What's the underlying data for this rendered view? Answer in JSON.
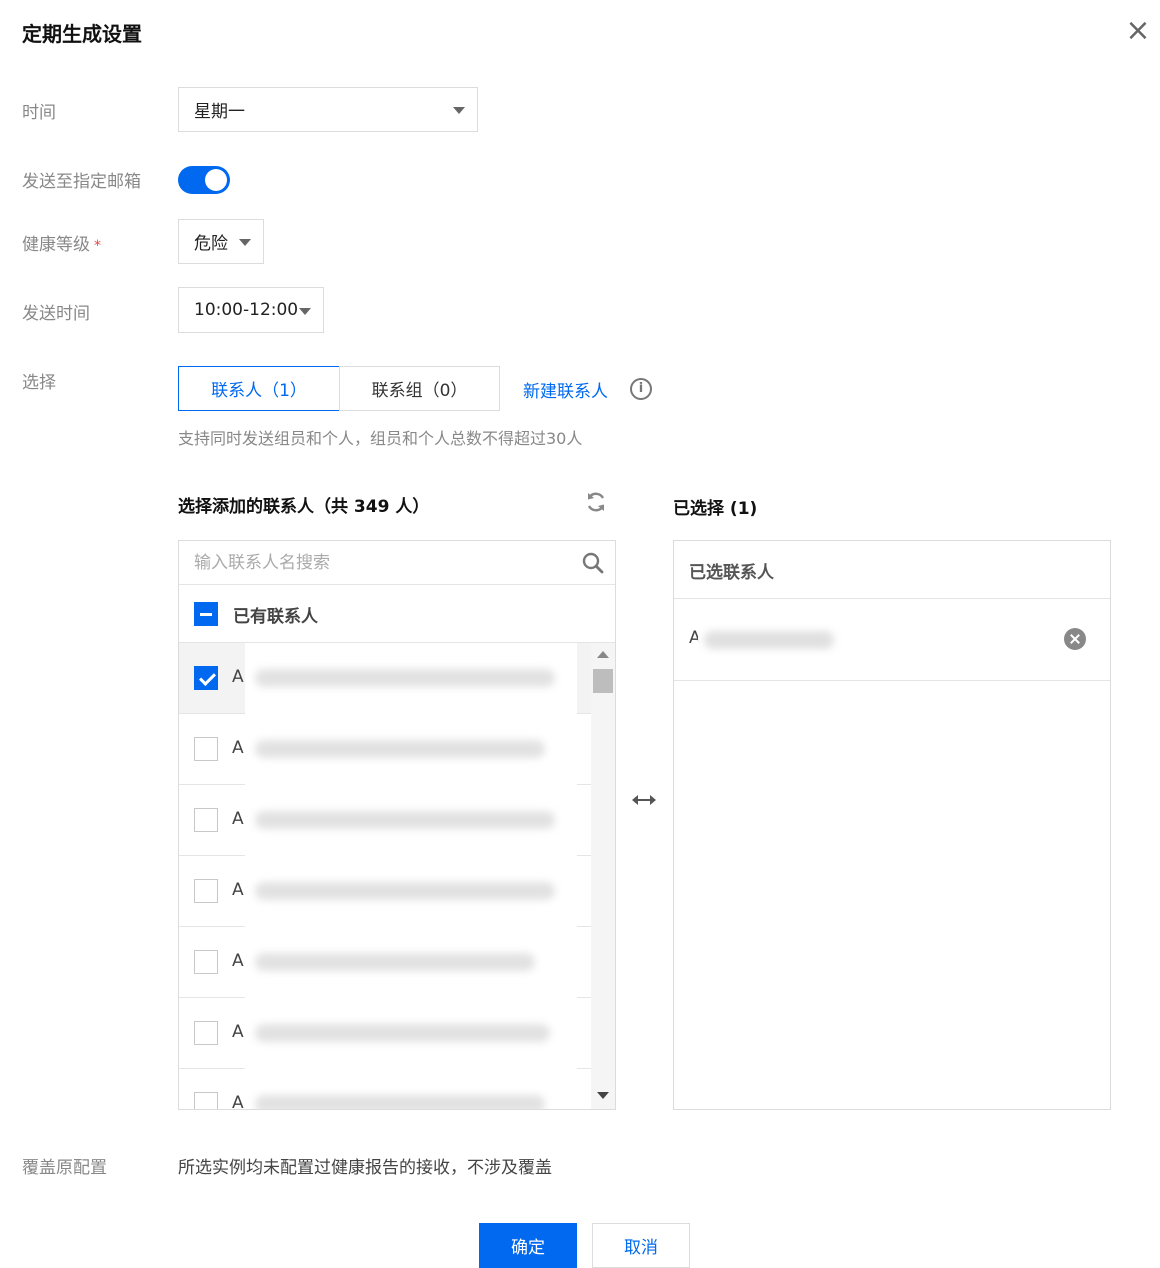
{
  "dialog": {
    "title": "定期生成设置",
    "close_icon": "close-icon"
  },
  "form": {
    "time": {
      "label": "时间",
      "value": "星期一"
    },
    "send_email": {
      "label": "发送至指定邮箱",
      "enabled": true
    },
    "health_level": {
      "label": "健康等级",
      "required_mark": "*",
      "value": "危险"
    },
    "send_time": {
      "label": "发送时间",
      "value": "10:00-12:00"
    },
    "select": {
      "label": "选择",
      "tabs": [
        {
          "label": "联系人（1）",
          "active": true
        },
        {
          "label": "联系组（0）",
          "active": false
        }
      ],
      "new_contact_link": "新建联系人",
      "hint": "支持同时发送组员和个人，组员和个人总数不得超过30人"
    }
  },
  "transfer": {
    "left": {
      "title": "选择添加的联系人（共 349 人）",
      "search_placeholder": "输入联系人名搜索",
      "group_label": "已有联系人",
      "items": [
        {
          "text": "A",
          "checked": true
        },
        {
          "text": "A",
          "checked": false
        },
        {
          "text": "A",
          "checked": false
        },
        {
          "text": "A",
          "checked": false
        },
        {
          "text": "A",
          "checked": false
        },
        {
          "text": "A",
          "checked": false
        },
        {
          "text": "A",
          "checked": false
        }
      ]
    },
    "right": {
      "title": "已选择 (1)",
      "header": "已选联系人",
      "items": [
        {
          "text": "A"
        }
      ]
    }
  },
  "override": {
    "label": "覆盖原配置",
    "text": "所选实例均未配置过健康报告的接收，不涉及覆盖"
  },
  "footer": {
    "confirm": "确定",
    "cancel": "取消"
  },
  "colors": {
    "primary": "#0069f0",
    "danger": "#e54545"
  }
}
